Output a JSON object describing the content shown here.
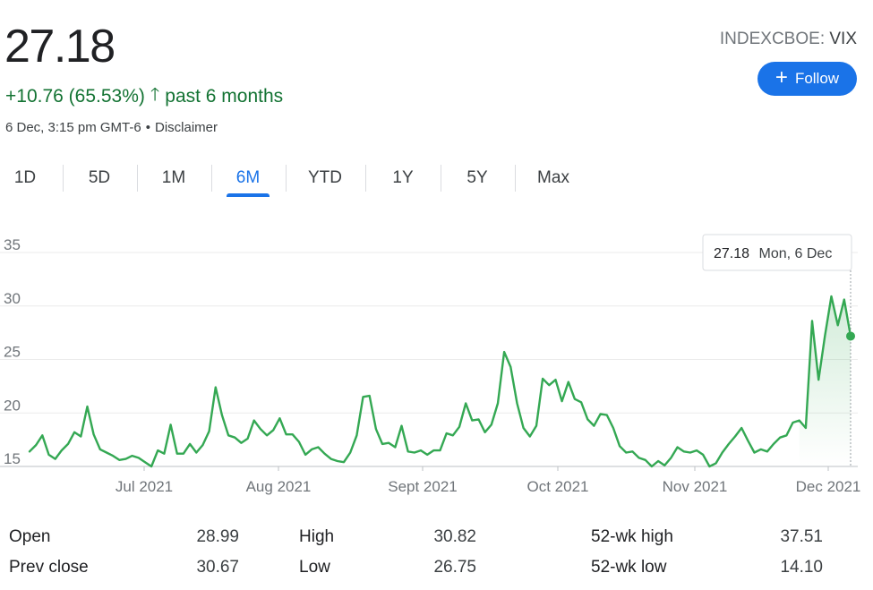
{
  "quote": {
    "price": "27.18",
    "change": "+10.76 (65.53%)",
    "change_arrow": "🡑",
    "period": "past 6 months",
    "timestamp": "6 Dec, 3:15 pm GMT-6",
    "separator": "•",
    "disclaimer": "Disclaimer",
    "exchange": "INDEXCBOE",
    "symbol": "VIX",
    "follow_label": "Follow",
    "accent_color": "#1a73e8",
    "positive_color": "#137333"
  },
  "tabs": [
    {
      "label": "1D",
      "active": false
    },
    {
      "label": "5D",
      "active": false
    },
    {
      "label": "1M",
      "active": false
    },
    {
      "label": "6M",
      "active": true
    },
    {
      "label": "YTD",
      "active": false
    },
    {
      "label": "1Y",
      "active": false
    },
    {
      "label": "5Y",
      "active": false
    },
    {
      "label": "Max",
      "active": false
    }
  ],
  "chart_data": {
    "type": "line",
    "color": "#34a853",
    "grid": true,
    "ylim": [
      15,
      35
    ],
    "y_ticks": [
      15,
      20,
      25,
      30,
      35
    ],
    "x_tick_labels": [
      "Jul 2021",
      "Aug 2021",
      "Sept 2021",
      "Oct 2021",
      "Nov 2021",
      "Dec 2021"
    ],
    "tooltip": {
      "value": "27.18",
      "date": "Mon, 6 Dec"
    },
    "series": [
      {
        "values": [
          16.4,
          17.0,
          17.9,
          16.1,
          15.7,
          16.5,
          17.1,
          18.2,
          17.8,
          20.6,
          18.0,
          16.6,
          16.3,
          16.0,
          15.6,
          15.7,
          16.0,
          15.8,
          15.4,
          15.0,
          16.5,
          16.2,
          18.9,
          16.2,
          16.2,
          17.1,
          16.3,
          17.0,
          18.3,
          22.4,
          19.8,
          17.9,
          17.7,
          17.2,
          17.6,
          19.3,
          18.5,
          17.9,
          18.4,
          19.5,
          18.0,
          18.0,
          17.3,
          16.1,
          16.6,
          16.8,
          16.2,
          15.7,
          15.5,
          15.4,
          16.3,
          17.9,
          21.5,
          21.6,
          18.5,
          17.1,
          17.2,
          16.8,
          18.8,
          16.4,
          16.3,
          16.5,
          16.1,
          16.5,
          16.5,
          18.1,
          17.9,
          18.7,
          20.9,
          19.3,
          19.4,
          18.2,
          18.9,
          20.9,
          25.7,
          24.3,
          20.9,
          18.6,
          17.8,
          18.8,
          23.2,
          22.6,
          23.1,
          21.1,
          22.9,
          21.3,
          21.0,
          19.4,
          18.8,
          19.9,
          19.8,
          18.6,
          16.9,
          16.3,
          16.4,
          15.8,
          15.6,
          15.0,
          15.5,
          15.1,
          15.8,
          16.8,
          16.4,
          16.3,
          16.5,
          16.1,
          15.0,
          15.3,
          16.3,
          17.1,
          17.8,
          18.6,
          17.4,
          16.3,
          16.6,
          16.4,
          17.1,
          17.7,
          17.9,
          19.1,
          19.3,
          18.6,
          28.6,
          23.1,
          27.2,
          30.9,
          28.2,
          30.6,
          27.18
        ]
      }
    ]
  },
  "stats": [
    {
      "label": "Open",
      "value": "28.99"
    },
    {
      "label": "Prev close",
      "value": "30.67"
    },
    {
      "label": "High",
      "value": "30.82"
    },
    {
      "label": "Low",
      "value": "26.75"
    },
    {
      "label": "52-wk high",
      "value": "37.51"
    },
    {
      "label": "52-wk low",
      "value": "14.10"
    }
  ]
}
